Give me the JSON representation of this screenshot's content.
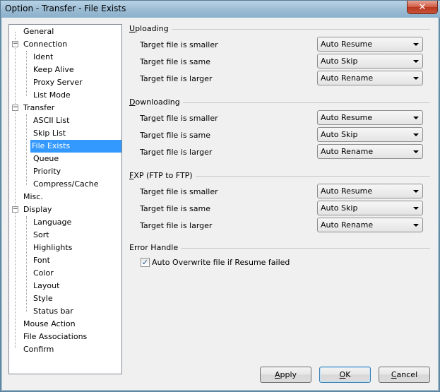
{
  "window": {
    "title": "Option - Transfer - File Exists",
    "close_label": "✕"
  },
  "tree": {
    "items": [
      {
        "label": "General"
      },
      {
        "label": "Connection",
        "expander": "−"
      },
      {
        "label": "Ident"
      },
      {
        "label": "Keep Alive"
      },
      {
        "label": "Proxy Server"
      },
      {
        "label": "List Mode"
      },
      {
        "label": "Transfer",
        "expander": "−"
      },
      {
        "label": "ASCII List"
      },
      {
        "label": "Skip List"
      },
      {
        "label": "File Exists",
        "selected": true
      },
      {
        "label": "Queue"
      },
      {
        "label": "Priority"
      },
      {
        "label": "Compress/Cache"
      },
      {
        "label": "Misc."
      },
      {
        "label": "Display",
        "expander": "−"
      },
      {
        "label": "Language"
      },
      {
        "label": "Sort"
      },
      {
        "label": "Highlights"
      },
      {
        "label": "Font"
      },
      {
        "label": "Color"
      },
      {
        "label": "Layout"
      },
      {
        "label": "Style"
      },
      {
        "label": "Status bar"
      },
      {
        "label": "Mouse Action"
      },
      {
        "label": "File Associations"
      },
      {
        "label": "Confirm"
      }
    ]
  },
  "uploading": {
    "title_u": "U",
    "title_rest": "ploading",
    "rows": [
      {
        "label": "Target file is smaller",
        "value": "Auto Resume"
      },
      {
        "label": "Target file is same",
        "value": "Auto Skip"
      },
      {
        "label": "Target file is larger",
        "value": "Auto Rename"
      }
    ]
  },
  "downloading": {
    "title_u": "D",
    "title_rest": "ownloading",
    "rows": [
      {
        "label": "Target file is smaller",
        "value": "Auto Resume"
      },
      {
        "label": "Target file is same",
        "value": "Auto Skip"
      },
      {
        "label": "Target file is larger",
        "value": "Auto Rename"
      }
    ]
  },
  "fxp": {
    "title_u": "F",
    "title_rest": "XP (FTP to FTP)",
    "rows": [
      {
        "label": "Target file is smaller",
        "value": "Auto Resume"
      },
      {
        "label": "Target file is same",
        "value": "Auto Skip"
      },
      {
        "label": "Target file is larger",
        "value": "Auto Rename"
      }
    ]
  },
  "error": {
    "title": "Error Handle",
    "checkbox_label": "Auto Overwrite file if Resume failed",
    "checked_mark": "✓"
  },
  "buttons": {
    "apply_u": "A",
    "apply_rest": "pply",
    "ok_u": "O",
    "ok_rest": "K",
    "cancel_u": "C",
    "cancel_rest": "ancel"
  }
}
